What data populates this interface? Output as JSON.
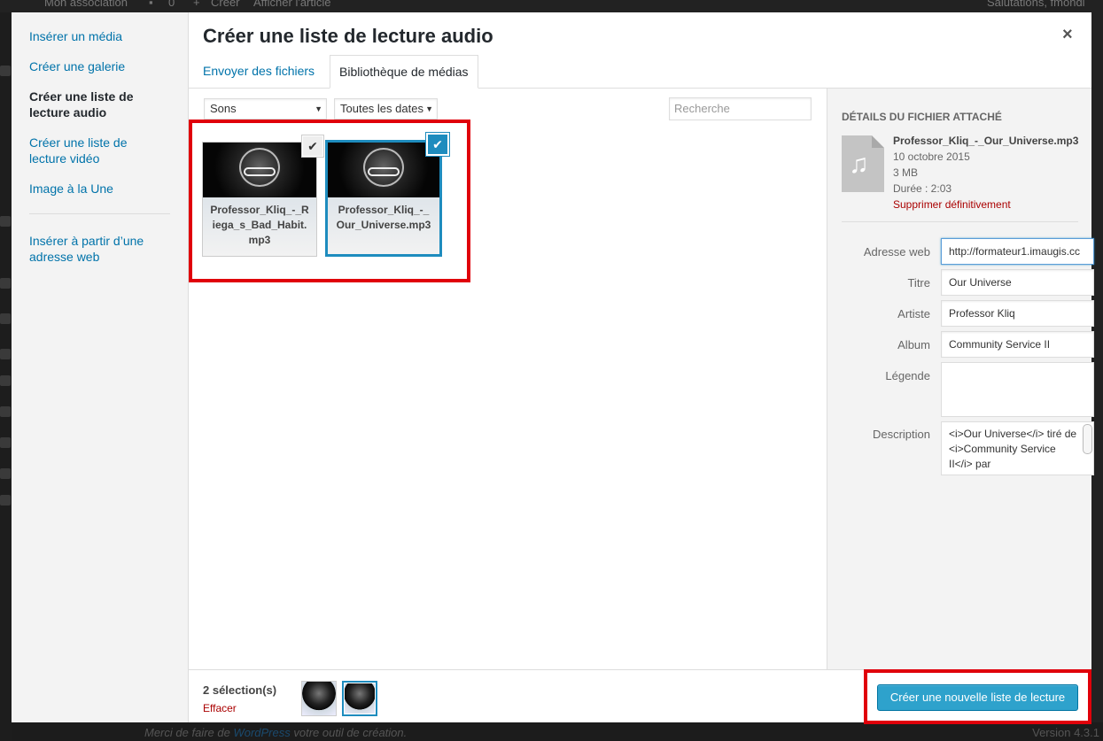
{
  "admin": {
    "site_name": "Mon association",
    "comments_count": "0",
    "new_label": "Créer",
    "view_label": "Afficher l'article",
    "greeting": "Salutations, fmondi",
    "footer_text_before": "Merci de faire de ",
    "footer_link": "WordPress",
    "footer_text_after": " votre outil de création.",
    "version": "Version 4.3.1"
  },
  "menu": {
    "insert_media": "Insérer un média",
    "create_gallery": "Créer une galerie",
    "create_audio_playlist": "Créer une liste de lecture audio",
    "create_video_playlist": "Créer une liste de lecture vidéo",
    "featured_image": "Image à la Une",
    "insert_from_url": "Insérer à partir d’une adresse web"
  },
  "modal": {
    "title": "Créer une liste de lecture audio",
    "close_icon": "×",
    "tabs": [
      "Envoyer des fichiers",
      "Bibliothèque de médias"
    ]
  },
  "filters": {
    "type": "Sons",
    "date": "Toutes les dates",
    "search_placeholder": "Recherche"
  },
  "attachments": [
    {
      "name": "Professor_Kliq_-_Riega_s_Bad_Habit.mp3",
      "selected": true,
      "details": false,
      "icon": "check-icon"
    },
    {
      "name": "Professor_Kliq_-_Our_Universe.mp3",
      "selected": true,
      "details": true,
      "icon": "check-icon"
    }
  ],
  "details": {
    "heading": "Détails du fichier attaché",
    "filename": "Professor_Kliq_-_Our_Universe.mp3",
    "date": "10 octobre 2015",
    "size": "3 MB",
    "duration": "Durée : 2:03",
    "delete_link": "Supprimer définitivement",
    "thumb_icon": "audio-file-icon",
    "fields": {
      "url_label": "Adresse web",
      "url_value": "http://formateur1.imaugis.cc",
      "title_label": "Titre",
      "title_value": "Our Universe",
      "artist_label": "Artiste",
      "artist_value": "Professor Kliq",
      "album_label": "Album",
      "album_value": "Community Service II",
      "caption_label": "Légende",
      "caption_value": "",
      "description_label": "Description",
      "description_value": "<i>Our Universe</i> tiré de <i>Community Service II</i> par"
    }
  },
  "toolbar": {
    "selection_count": "2 sélection(s)",
    "clear_label": "Effacer",
    "create_button": "Créer une nouvelle liste de lecture"
  },
  "colors": {
    "accent": "#0073aa",
    "selected_border": "#1e8cbe",
    "primary_button": "#2ea2cc",
    "highlight_box": "#e0000a",
    "delete": "#aa0000"
  }
}
